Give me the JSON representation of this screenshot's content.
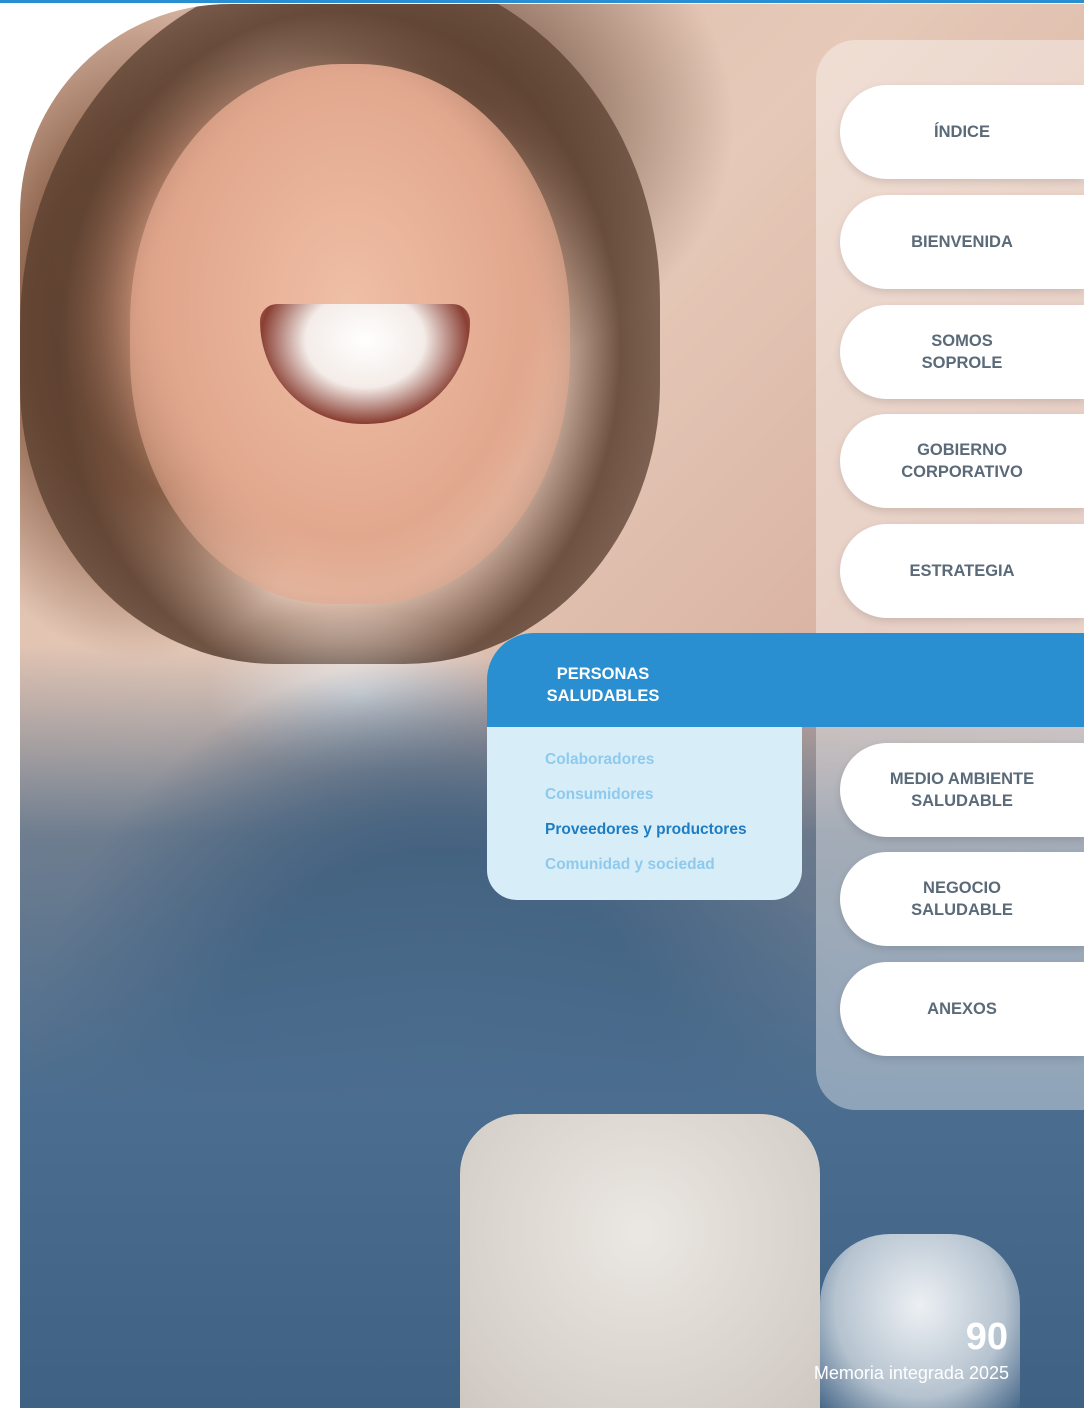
{
  "nav": {
    "items": [
      {
        "label": "ÍNDICE"
      },
      {
        "label": "BIENVENIDA"
      },
      {
        "label": "SOMOS\nSOPROLE"
      },
      {
        "label": "GOBIERNO\nCORPORATIVO"
      },
      {
        "label": "ESTRATEGIA"
      },
      {
        "label": "MEDIO AMBIENTE\nSALUDABLE"
      },
      {
        "label": "NEGOCIO\nSALUDABLE"
      },
      {
        "label": "ANEXOS"
      }
    ],
    "active": {
      "label": "PERSONAS\nSALUDABLES",
      "subitems": [
        {
          "label": "Colaboradores"
        },
        {
          "label": "Consumidores"
        },
        {
          "label": "Proveedores y productores"
        },
        {
          "label": "Comunidad y sociedad"
        }
      ]
    }
  },
  "footer": {
    "page_number": "90",
    "report_title": "Memoria integrada 2025"
  },
  "colors": {
    "accent": "#2a8fd0",
    "subitem": "#8fc9ec",
    "subitem_current": "#1e7dc2",
    "nav_text": "#5a6a78"
  }
}
